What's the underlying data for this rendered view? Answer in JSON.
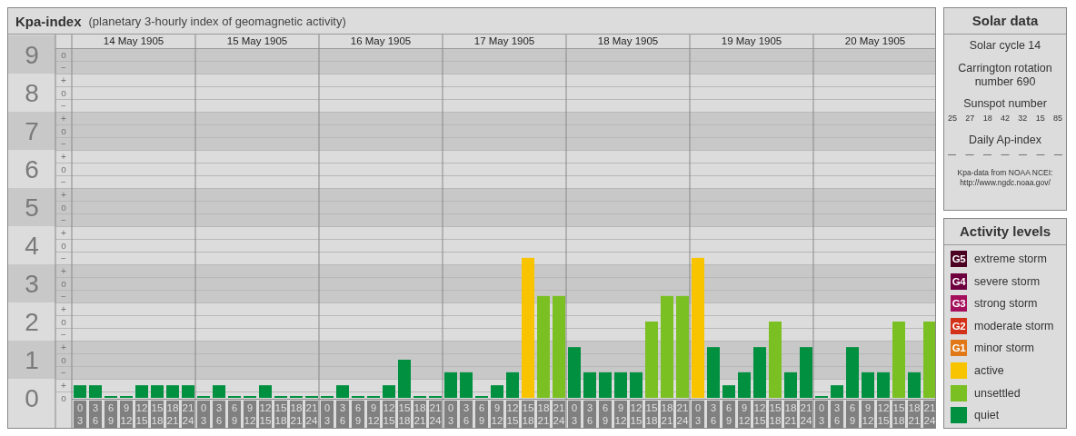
{
  "kp_panel": {
    "title": "Kpa-index",
    "subtitle": "(planetary 3-hourly index of geomagnetic activity)",
    "days": [
      {
        "date": "14 May 1905",
        "intervals": [
          [
            "0",
            "3"
          ],
          [
            "3",
            "6"
          ],
          [
            "6",
            "9"
          ],
          [
            "9",
            "12"
          ],
          [
            "12",
            "15"
          ],
          [
            "15",
            "18"
          ],
          [
            "18",
            "21"
          ],
          [
            "21",
            "24"
          ]
        ]
      },
      {
        "date": "15 May 1905",
        "intervals": [
          [
            "0",
            "3"
          ],
          [
            "3",
            "6"
          ],
          [
            "6",
            "9"
          ],
          [
            "9",
            "12"
          ],
          [
            "12",
            "15"
          ],
          [
            "15",
            "18"
          ],
          [
            "18",
            "21"
          ],
          [
            "21",
            "24"
          ]
        ]
      },
      {
        "date": "16 May 1905",
        "intervals": [
          [
            "0",
            "3"
          ],
          [
            "3",
            "6"
          ],
          [
            "6",
            "9"
          ],
          [
            "9",
            "12"
          ],
          [
            "12",
            "15"
          ],
          [
            "15",
            "18"
          ],
          [
            "18",
            "21"
          ],
          [
            "21",
            "24"
          ]
        ]
      },
      {
        "date": "17 May 1905",
        "intervals": [
          [
            "0",
            "3"
          ],
          [
            "3",
            "6"
          ],
          [
            "6",
            "9"
          ],
          [
            "9",
            "12"
          ],
          [
            "12",
            "15"
          ],
          [
            "15",
            "18"
          ],
          [
            "18",
            "21"
          ],
          [
            "21",
            "24"
          ]
        ]
      },
      {
        "date": "18 May 1905",
        "intervals": [
          [
            "0",
            "3"
          ],
          [
            "3",
            "6"
          ],
          [
            "6",
            "9"
          ],
          [
            "9",
            "12"
          ],
          [
            "12",
            "15"
          ],
          [
            "15",
            "18"
          ],
          [
            "18",
            "21"
          ],
          [
            "21",
            "24"
          ]
        ]
      },
      {
        "date": "19 May 1905",
        "intervals": [
          [
            "0",
            "3"
          ],
          [
            "3",
            "6"
          ],
          [
            "6",
            "9"
          ],
          [
            "9",
            "12"
          ],
          [
            "12",
            "15"
          ],
          [
            "15",
            "18"
          ],
          [
            "18",
            "21"
          ],
          [
            "21",
            "24"
          ]
        ]
      },
      {
        "date": "20 May 1905",
        "intervals": [
          [
            "0",
            "3"
          ],
          [
            "3",
            "6"
          ],
          [
            "6",
            "9"
          ],
          [
            "9",
            "12"
          ],
          [
            "12",
            "15"
          ],
          [
            "15",
            "18"
          ],
          [
            "18",
            "21"
          ],
          [
            "21",
            "24"
          ]
        ]
      }
    ],
    "sublevel_marks": [
      "o",
      "−",
      "+",
      "o",
      "−",
      "+",
      "o",
      "−",
      "+",
      "o",
      "−",
      "+",
      "o",
      "−",
      "+",
      "o",
      "−",
      "+",
      "o",
      "−",
      "+",
      "o",
      "−",
      "+",
      "o",
      "−",
      "+",
      "o"
    ],
    "chart_data": {
      "type": "bar",
      "grid": true,
      "ylim": [
        0,
        9.52
      ],
      "yticks": [
        {
          "value": 9,
          "label": "9"
        },
        {
          "value": 8,
          "label": "8"
        },
        {
          "value": 7,
          "label": "7"
        },
        {
          "value": 6,
          "label": "6"
        },
        {
          "value": 5,
          "label": "5"
        },
        {
          "value": 4,
          "label": "4"
        },
        {
          "value": 3,
          "label": "3"
        },
        {
          "value": 2,
          "label": "2"
        },
        {
          "value": 1,
          "label": "1"
        },
        {
          "value": 0,
          "label": "0"
        }
      ],
      "series": [
        {
          "name": "quiet",
          "color": "#00903f",
          "values": [
            0.33,
            0.33,
            0,
            0,
            0.33,
            0.33,
            0.33,
            0.33,
            0,
            0.33,
            0,
            0,
            0.33,
            0,
            0,
            0,
            0,
            0.33,
            0,
            0,
            0.33,
            1,
            0,
            0,
            0.67,
            0.67,
            0,
            0.33,
            0.67,
            null,
            null,
            null,
            1.33,
            0.67,
            0.67,
            0.67,
            0.67,
            null,
            null,
            null,
            null,
            1.33,
            0.33,
            0.67,
            1.33,
            null,
            0.67,
            1.33,
            0,
            0.33,
            1.33,
            0.67,
            0.67,
            null,
            0.67,
            null
          ]
        },
        {
          "name": "unsettled",
          "color": "#7bc023",
          "values": [
            null,
            null,
            null,
            null,
            null,
            null,
            null,
            null,
            null,
            null,
            null,
            null,
            null,
            null,
            null,
            null,
            null,
            null,
            null,
            null,
            null,
            null,
            null,
            null,
            null,
            null,
            null,
            null,
            null,
            null,
            2.67,
            2.67,
            null,
            null,
            null,
            null,
            null,
            2,
            2.67,
            2.67,
            null,
            null,
            null,
            null,
            null,
            2,
            null,
            null,
            null,
            null,
            null,
            null,
            null,
            2,
            null,
            2
          ]
        },
        {
          "name": "active",
          "color": "#f8c400",
          "values": [
            null,
            null,
            null,
            null,
            null,
            null,
            null,
            null,
            null,
            null,
            null,
            null,
            null,
            null,
            null,
            null,
            null,
            null,
            null,
            null,
            null,
            null,
            null,
            null,
            null,
            null,
            null,
            null,
            null,
            3.67,
            null,
            null,
            null,
            null,
            null,
            null,
            null,
            null,
            null,
            null,
            3.67,
            null,
            null,
            null,
            null,
            null,
            null,
            null,
            null,
            null,
            null,
            null,
            null,
            null,
            null,
            null
          ]
        }
      ]
    }
  },
  "solar_data": {
    "title": "Solar data",
    "solar_cycle": "Solar cycle 14",
    "carrington": "Carrington rotation number 690",
    "sunspot_heading": "Sunspot number",
    "sunspot_numbers": [
      "25",
      "27",
      "18",
      "42",
      "32",
      "15",
      "85"
    ],
    "ap_heading": "Daily Ap-index",
    "ap_values": [
      "—",
      "—",
      "—",
      "—",
      "—",
      "—",
      "—"
    ],
    "source": "Kpa-data from NOAA NCEI:",
    "source_link": "http://www.ngdc.noaa.gov/"
  },
  "activity_levels": {
    "title": "Activity levels",
    "items": [
      {
        "badge": "G5",
        "label": "extreme storm",
        "color": "#4c0022"
      },
      {
        "badge": "G4",
        "label": "severe storm",
        "color": "#6e0040"
      },
      {
        "badge": "G3",
        "label": "strong storm",
        "color": "#a5105c"
      },
      {
        "badge": "G2",
        "label": "moderate storm",
        "color": "#d3321a"
      },
      {
        "badge": "G1",
        "label": "minor storm",
        "color": "#e07818"
      }
    ]
  }
}
